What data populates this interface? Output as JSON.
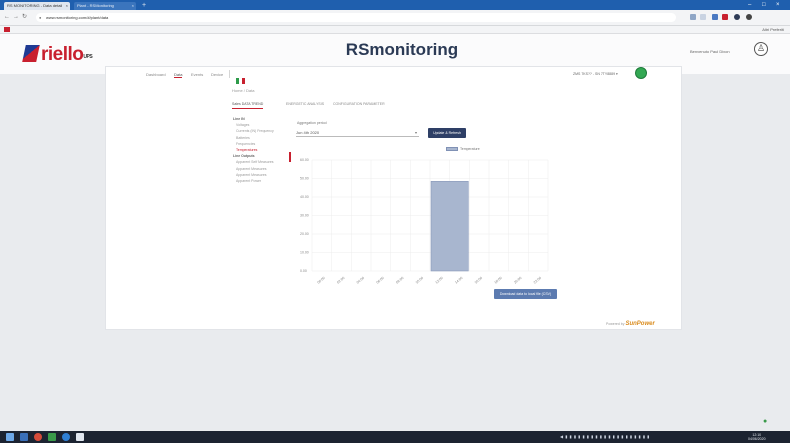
{
  "browser": {
    "tabs": [
      {
        "label": "RS MONITORING - Data detail",
        "active": true
      },
      {
        "label": "Plant - RSMonitoring",
        "active": false
      }
    ],
    "new_tab_label": "+",
    "window_controls": [
      "–",
      "□",
      "×"
    ],
    "url": "www.rsmonitoring.com/#/plant/data",
    "bookmarks_right": "Altri Preferiti"
  },
  "site": {
    "app_title": "RSmonitoring",
    "logo_text": "riello",
    "logo_sub": "UPS",
    "user_name": "Benvenuto Paul Dixon",
    "top_nav": [
      "Dashboard",
      "Data",
      "Events",
      "Device"
    ],
    "device_serial": "ZMS 7KS?? - SN 7TY8889 ▾",
    "breadcrumb": "Home  /  Data"
  },
  "data_page": {
    "sub_tabs": [
      "Sales DATA TREND",
      "ENERGETIC ANALYSIS",
      "CONFIGURATION PARAMETER"
    ],
    "sidebar": [
      {
        "label": "Line IN",
        "type": "head"
      },
      {
        "label": "Voltages",
        "type": "item"
      },
      {
        "label": "Currents (IN) Frequency",
        "type": "item"
      },
      {
        "label": "Batteries",
        "type": "item"
      },
      {
        "label": "Frequencies",
        "type": "item"
      },
      {
        "label": "Temperatures",
        "type": "selected"
      },
      {
        "label": "Line Outputs",
        "type": "head"
      },
      {
        "label": "Apparent Self Measures",
        "type": "item"
      },
      {
        "label": "Apparent Measures",
        "type": "item"
      },
      {
        "label": "Apparent Measures",
        "type": "item"
      },
      {
        "label": "Apparent Power",
        "type": "item"
      }
    ],
    "field_label": "Aggregation period",
    "select_value": "Jun 4th 2020",
    "update_label": "Update & Refresh",
    "export_label": "Download data to local file (CSV)",
    "powered_by": "Powered by",
    "powered_brand": "SunPower"
  },
  "chart_data": {
    "type": "bar",
    "series": [
      {
        "name": "Temperature",
        "values": [
          0,
          0,
          0,
          0,
          0,
          0,
          48.5,
          0,
          0,
          0,
          0,
          0
        ]
      }
    ],
    "categories": [
      "00:00",
      "02:00",
      "04:00",
      "06:00",
      "08:00",
      "10:00",
      "12:00",
      "14:00",
      "16:00",
      "18:00",
      "20:00",
      "22:00"
    ],
    "y_ticks": [
      "60.00",
      "50.00",
      "40.00",
      "30.00",
      "20.00",
      "10.00",
      "0.00"
    ],
    "ylim": [
      0,
      60
    ],
    "grid": true,
    "legend": "top-center",
    "bar_color": "#a8b6cf",
    "bar_border": "#8091b5"
  },
  "taskbar": {
    "tray_text": "◀ ▮ ▮ ▮ ▮ ▮ ▮ ▮ ▮ ▮ ▮ ▮ ▮ ▮ ▮ ▮ ▮ ▮ ▮ ▮ ▮",
    "clock_time": "12:10",
    "clock_date": "04/06/2020"
  }
}
